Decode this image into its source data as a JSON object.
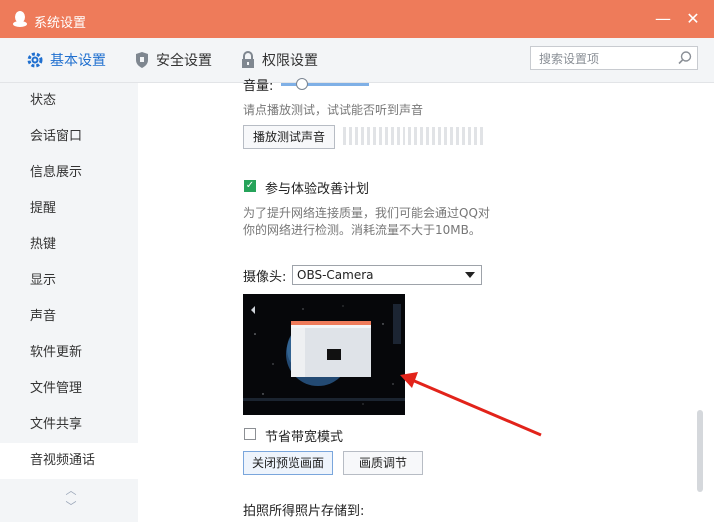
{
  "window": {
    "title": "系统设置",
    "min_glyph": "—",
    "close_glyph": "✕"
  },
  "tabs": [
    {
      "label": "基本设置",
      "icon": "gear-icon",
      "active": true
    },
    {
      "label": "安全设置",
      "icon": "shield-icon"
    },
    {
      "label": "权限设置",
      "icon": "lock-icon"
    }
  ],
  "search": {
    "placeholder": "搜索设置项",
    "value": ""
  },
  "sidebar": {
    "items": [
      "状态",
      "会话窗口",
      "信息展示",
      "提醒",
      "热键",
      "显示",
      "声音",
      "软件更新",
      "文件管理",
      "文件共享",
      "音视频通话"
    ],
    "active": "音视频通话",
    "up_glyph": "︿",
    "down_glyph": "﹀"
  },
  "content": {
    "volume_label": "音量:",
    "play_hint": "请点播放测试，试试能否听到声音",
    "play_button": "播放测试声音",
    "improve_checkbox": "参与体验改善计划",
    "improve_checked": true,
    "improve_hint_1": "为了提升网络连接质量，我们可能会通过QQ对",
    "improve_hint_2": "你的网络进行检测。消耗流量不大于10MB。",
    "camera_label": "摄像头:",
    "camera_value": "OBS-Camera",
    "bandwidth_checkbox": "节省带宽模式",
    "bandwidth_checked": false,
    "close_preview_button": "关闭预览画面",
    "quality_button": "画质调节",
    "photo_save_label": "拍照所得照片存储到:"
  },
  "colors": {
    "titlebar": "#ee7b5a",
    "active_tab": "#1f6fcf",
    "checkbox_checked": "#26a35a",
    "annotation_arrow": "#e2231a"
  }
}
